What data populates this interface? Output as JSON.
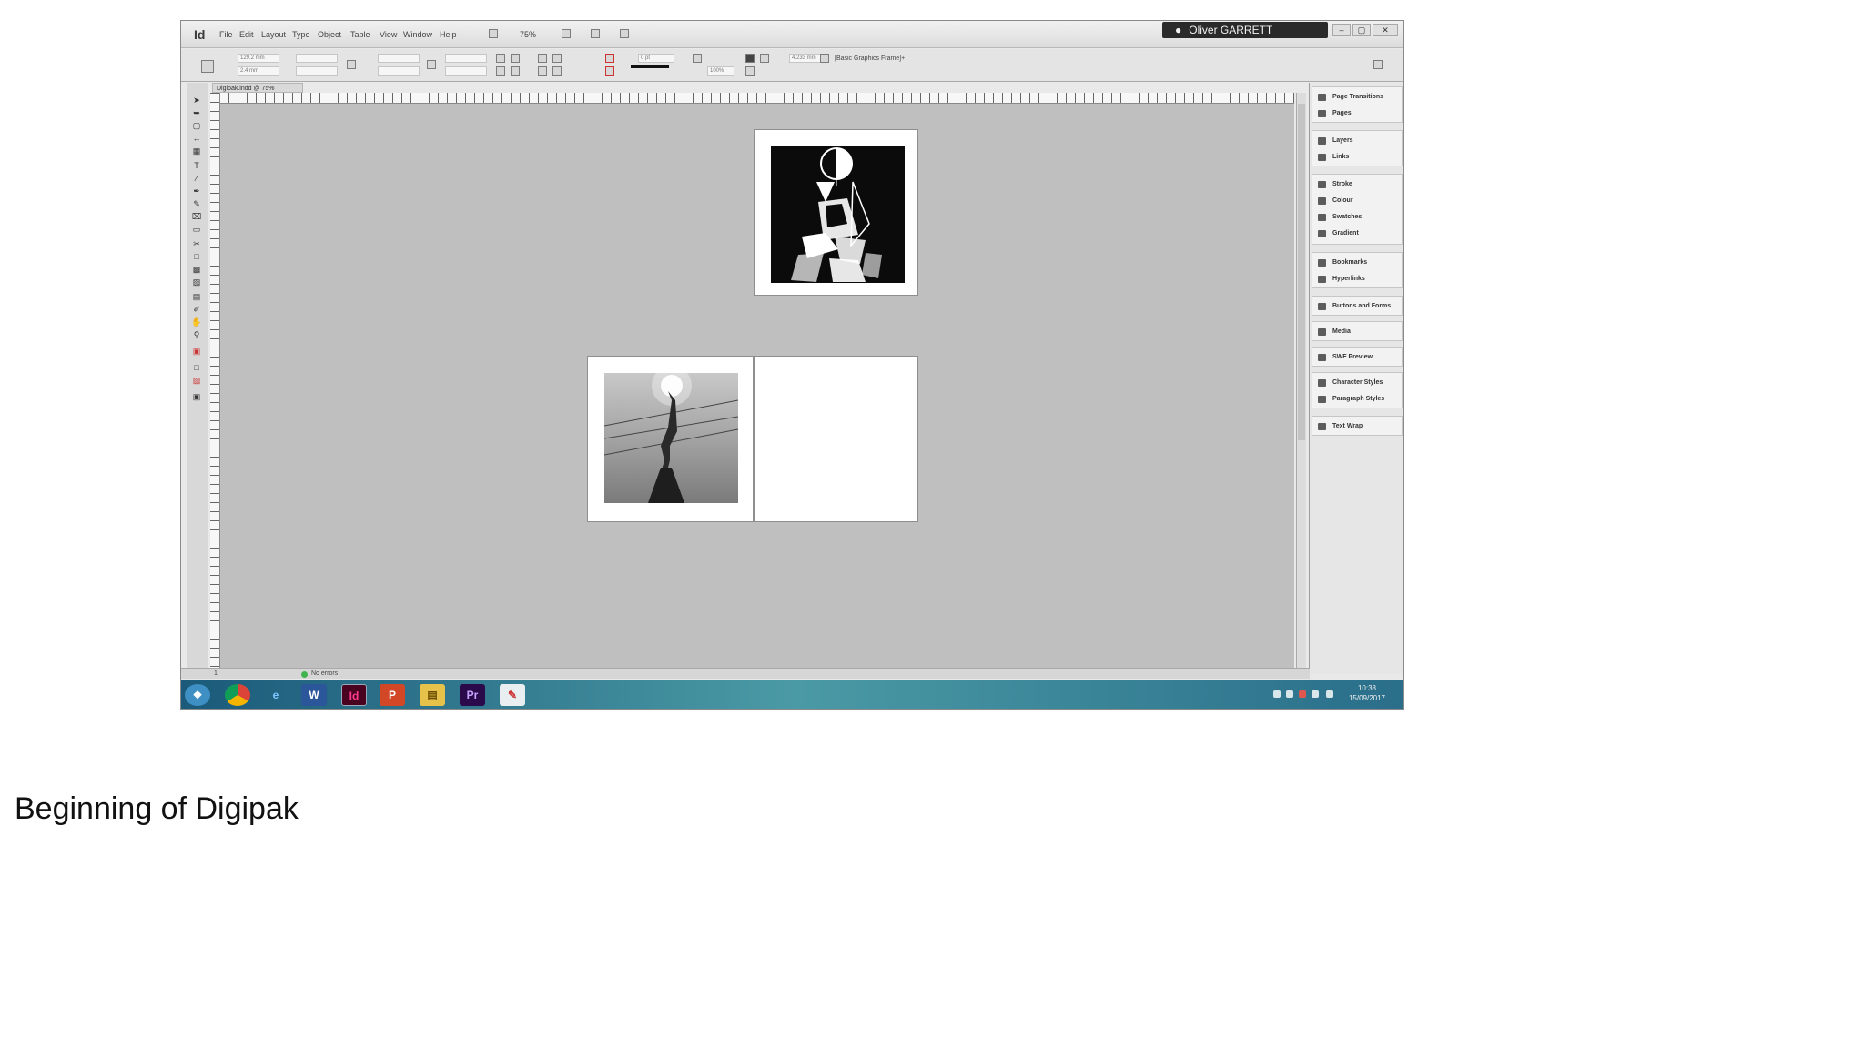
{
  "app": {
    "logo": "Id"
  },
  "menu": [
    "File",
    "Edit",
    "Layout",
    "Type",
    "Object",
    "Table",
    "View",
    "Window",
    "Help"
  ],
  "zoom_display": "75%",
  "user": {
    "name": "Oliver GARRETT"
  },
  "window_buttons": [
    "–",
    "▢",
    "✕"
  ],
  "controlbar": {
    "x_field": "129.2 mm",
    "y_field": "2.4 mm",
    "stroke_weight": "0 pt",
    "opacity": "100%",
    "ref_width": "4.233 mm",
    "frame_style": "[Basic Graphics Frame]+"
  },
  "document_tab": "Digipak.indd @ 75%",
  "panels": [
    {
      "group": 1,
      "items": [
        "Page Transitions",
        "Pages"
      ]
    },
    {
      "group": 2,
      "items": [
        "Layers",
        "Links"
      ]
    },
    {
      "group": 3,
      "items": [
        "Stroke",
        "Colour",
        "Swatches",
        "Gradient"
      ]
    },
    {
      "group": 4,
      "items": [
        "Bookmarks",
        "Hyperlinks"
      ]
    },
    {
      "group": 5,
      "items": [
        "Buttons and Forms"
      ]
    },
    {
      "group": 6,
      "items": [
        "Media"
      ]
    },
    {
      "group": 7,
      "items": [
        "SWF Preview"
      ]
    },
    {
      "group": 8,
      "items": [
        "Character Styles",
        "Paragraph Styles"
      ]
    },
    {
      "group": 9,
      "items": [
        "Text Wrap"
      ]
    }
  ],
  "status": {
    "preflight": "No errors",
    "page": "1"
  },
  "taskbar": {
    "apps": [
      "start-icon",
      "chrome-icon",
      "ie-icon",
      "word-icon",
      "indesign-icon",
      "powerpoint-icon",
      "files-icon",
      "premiere-icon",
      "paint-icon"
    ],
    "time": "10:38",
    "date": "15/09/2017"
  },
  "colors": {
    "pasteboard": "#bfbfbf",
    "user_badge": "#2a2a2a",
    "taskbar": "#2a7a8a"
  },
  "caption": "Beginning of Digipak"
}
